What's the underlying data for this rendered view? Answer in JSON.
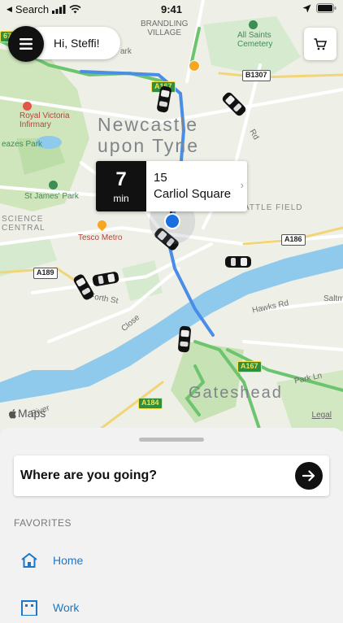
{
  "status_bar": {
    "back_label": "Search",
    "time": "9:41"
  },
  "header": {
    "greeting": "Hi, Steffi!"
  },
  "map": {
    "labels": {
      "brandling_village": "BRANDLING\nVILLAGE",
      "all_saints_cemetery": "All Saints\nCemetery",
      "royal_victoria": "Royal Victoria\nInfirmary",
      "leazes_park": "eazes Park",
      "st_james_park": "St James' Park",
      "science_central": "SCIENCE\nCENTRAL",
      "tesco": "Tesco Metro",
      "castle_field": "ATTLE FIELD",
      "forth_st": "Forth St",
      "close": "Close",
      "hawks_rd": "Hawks Rd",
      "park_ln": "Park Ln",
      "river": "River",
      "saltm": "Saltm",
      "park_top": "ark",
      "rd": "Rd",
      "city_newcastle": "Newcastle\nupon Tyne",
      "city_gateshead": "Gateshead"
    },
    "shields": {
      "b1307": "B1307",
      "a186": "A186",
      "a189": "A189",
      "a167": "A167",
      "a184": "A184",
      "a167m": "A167",
      "g67": "67"
    },
    "maps_logo": "Maps",
    "legal": "Legal",
    "colors": {
      "route": "#4a8de8",
      "green_road": "#6dc46e",
      "water": "#8fc9ec",
      "park": "#c7e2b4"
    }
  },
  "eta": {
    "minutes": "7",
    "unit": "min",
    "line1": "15",
    "line2": "Carliol Square"
  },
  "sheet": {
    "search_label": "Where are you going?",
    "favorites_title": "FAVORITES",
    "favorites": [
      {
        "label": "Home",
        "icon": "house-icon"
      },
      {
        "label": "Work",
        "icon": "building-icon"
      }
    ]
  }
}
